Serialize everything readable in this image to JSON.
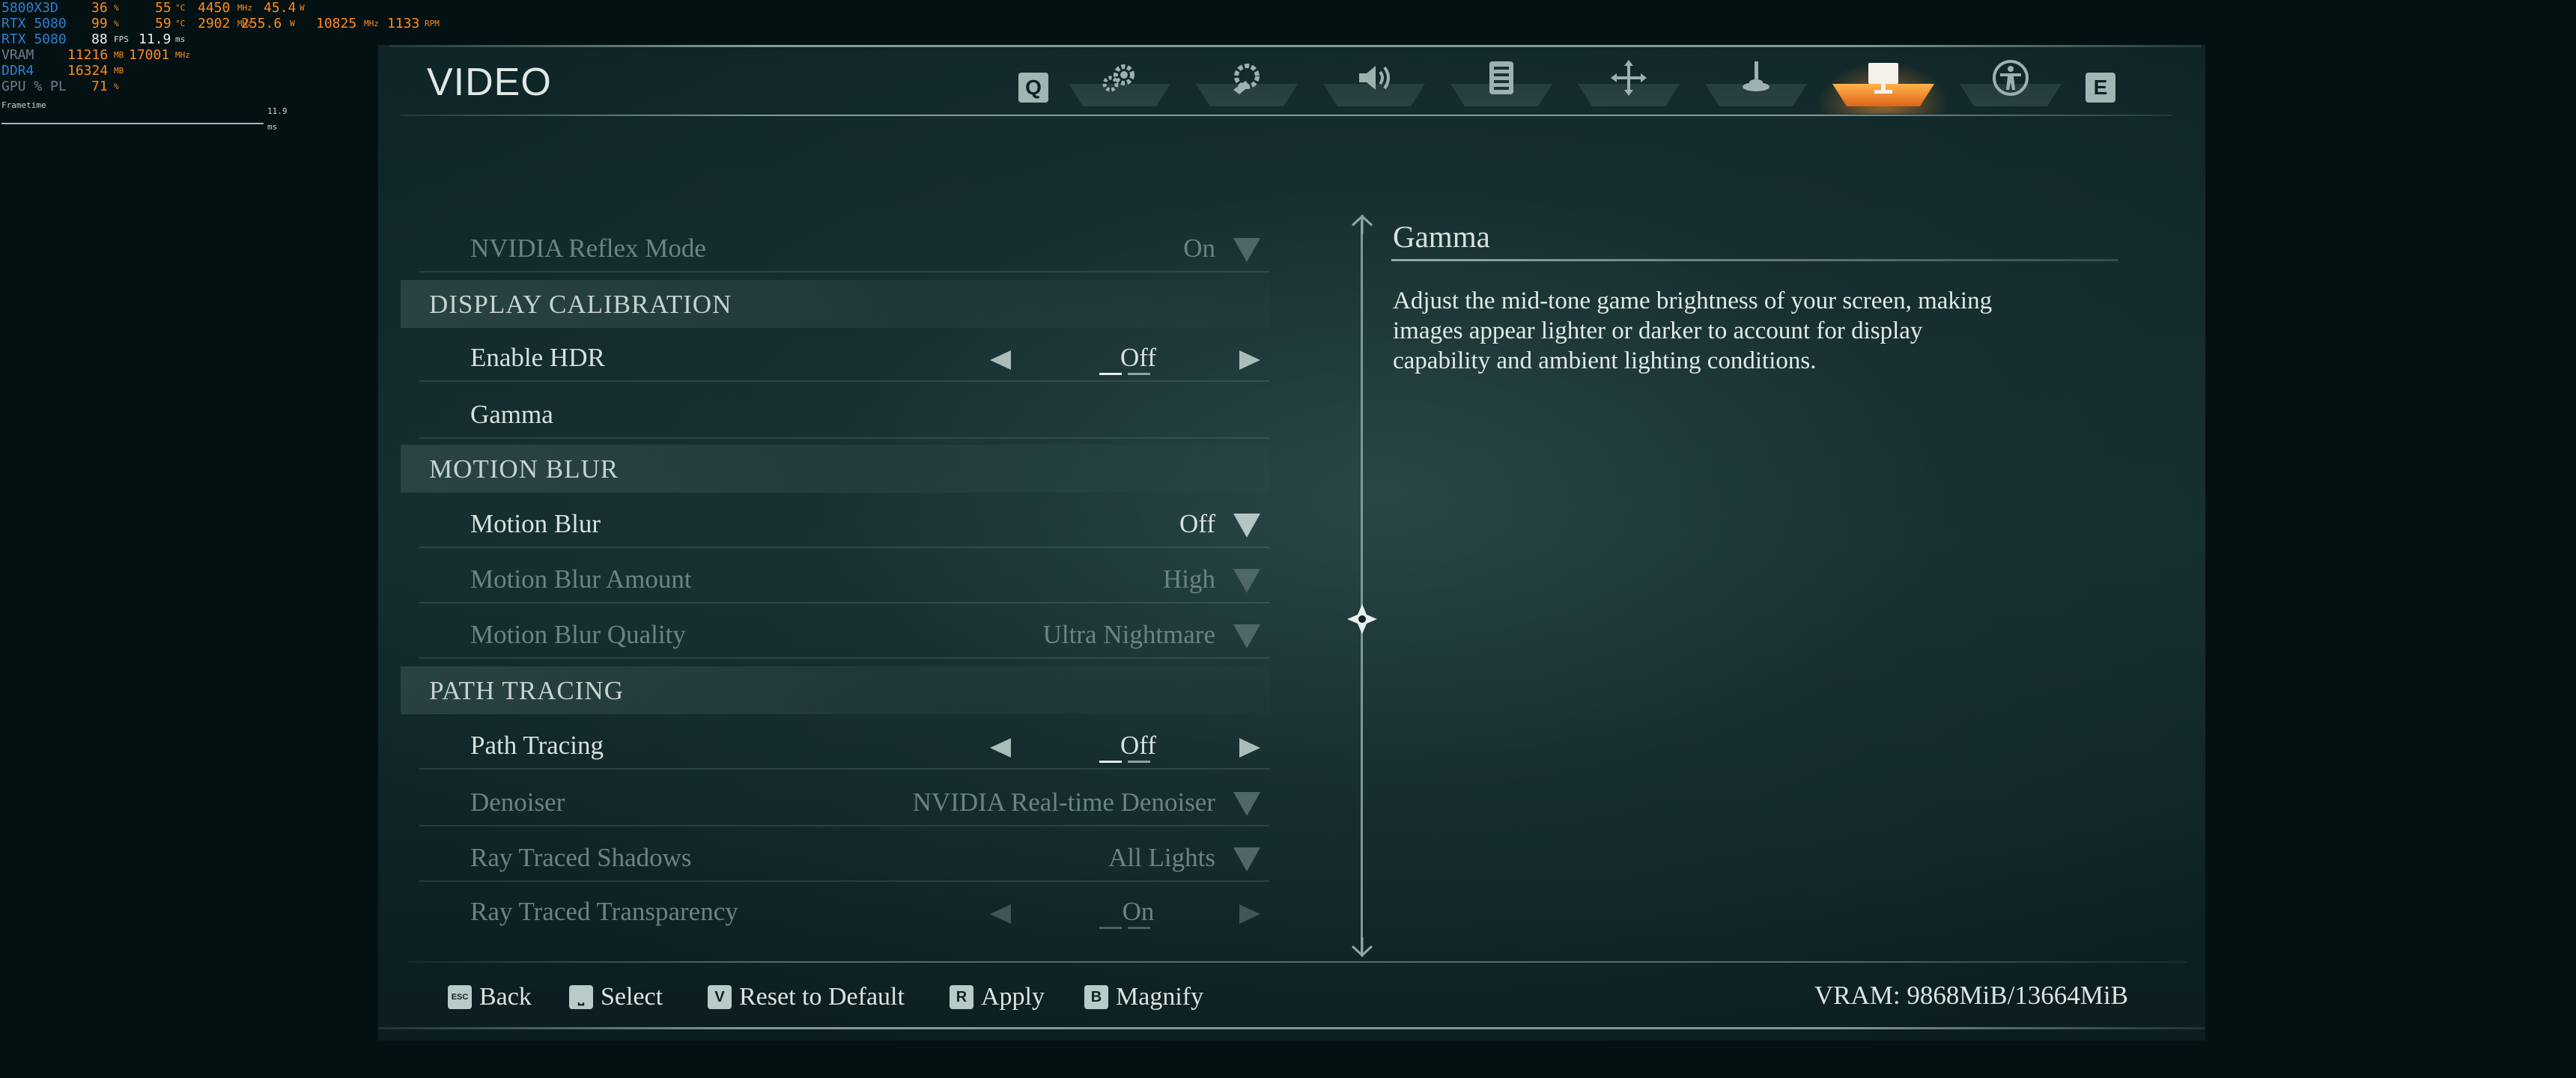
{
  "overlay": {
    "rows": [
      {
        "label": "5800X3D",
        "v1": "36",
        "u1": "%",
        "v2": "55",
        "u2": "°C",
        "v3": "4450",
        "u3": "MHz",
        "v4": "45.4",
        "u4": "W"
      },
      {
        "label": "RTX 5080",
        "v1": "99",
        "u1": "%",
        "v2": "59",
        "u2": "°C",
        "v3": "2902",
        "u3": "MHz",
        "v4": "255.6",
        "u4": "W",
        "v5": "10825",
        "u5": "MHz",
        "v6": "1133",
        "u6": "RPM"
      },
      {
        "label": "RTX 5080",
        "v1": "88",
        "u1": "FPS",
        "v2": "11.9",
        "u2": "ms"
      },
      {
        "label": "VRAM",
        "v1": "11216",
        "u1": "MB",
        "v2": "17001",
        "u2": "MHz"
      },
      {
        "label": "DDR4",
        "v1": "16324",
        "u1": "MB"
      },
      {
        "label": "GPU % PL",
        "v1": "71",
        "u1": "%"
      }
    ],
    "frametime_label": "Frametime",
    "frametime_ms": "11.9 ms"
  },
  "header": {
    "title": "VIDEO",
    "prev_key": "Q",
    "next_key": "E",
    "tabs": [
      "settings",
      "controls",
      "audio",
      "display-list",
      "keybindings",
      "hud",
      "video",
      "accessibility"
    ],
    "active_tab": "video"
  },
  "settings": {
    "reflex": {
      "label": "NVIDIA Reflex Mode",
      "value": "On"
    },
    "display_calibration": "DISPLAY CALIBRATION",
    "hdr": {
      "label": "Enable HDR",
      "value": "Off"
    },
    "gamma": {
      "label": "Gamma"
    },
    "motion_blur_section": "MOTION BLUR",
    "motion_blur": {
      "label": "Motion Blur",
      "value": "Off"
    },
    "motion_blur_amount": {
      "label": "Motion Blur Amount",
      "value": "High"
    },
    "motion_blur_quality": {
      "label": "Motion Blur Quality",
      "value": "Ultra Nightmare"
    },
    "path_tracing_section": "PATH TRACING",
    "path_tracing": {
      "label": "Path Tracing",
      "value": "Off"
    },
    "denoiser": {
      "label": "Denoiser",
      "value": "NVIDIA Real-time Denoiser"
    },
    "rt_shadows": {
      "label": "Ray Traced Shadows",
      "value": "All Lights"
    },
    "rt_transparency": {
      "label": "Ray Traced Transparency",
      "value": "On"
    }
  },
  "description": {
    "title": "Gamma",
    "text": "Adjust the mid-tone game brightness of your screen, making images appear lighter or darker to account for display capability and ambient lighting conditions."
  },
  "footer": {
    "back": {
      "key": "ESC",
      "label": "Back"
    },
    "select": {
      "key": "⎵",
      "label": "Select"
    },
    "reset": {
      "key": "V",
      "label": "Reset to Default"
    },
    "apply": {
      "key": "R",
      "label": "Apply"
    },
    "magnify": {
      "key": "B",
      "label": "Magnify"
    },
    "vram": "VRAM: 9868MiB/13664MiB"
  },
  "colors": {
    "accent": "#ff8a1a",
    "text": "#d7e1df",
    "dim": "#6b8483",
    "background": "#041113"
  }
}
